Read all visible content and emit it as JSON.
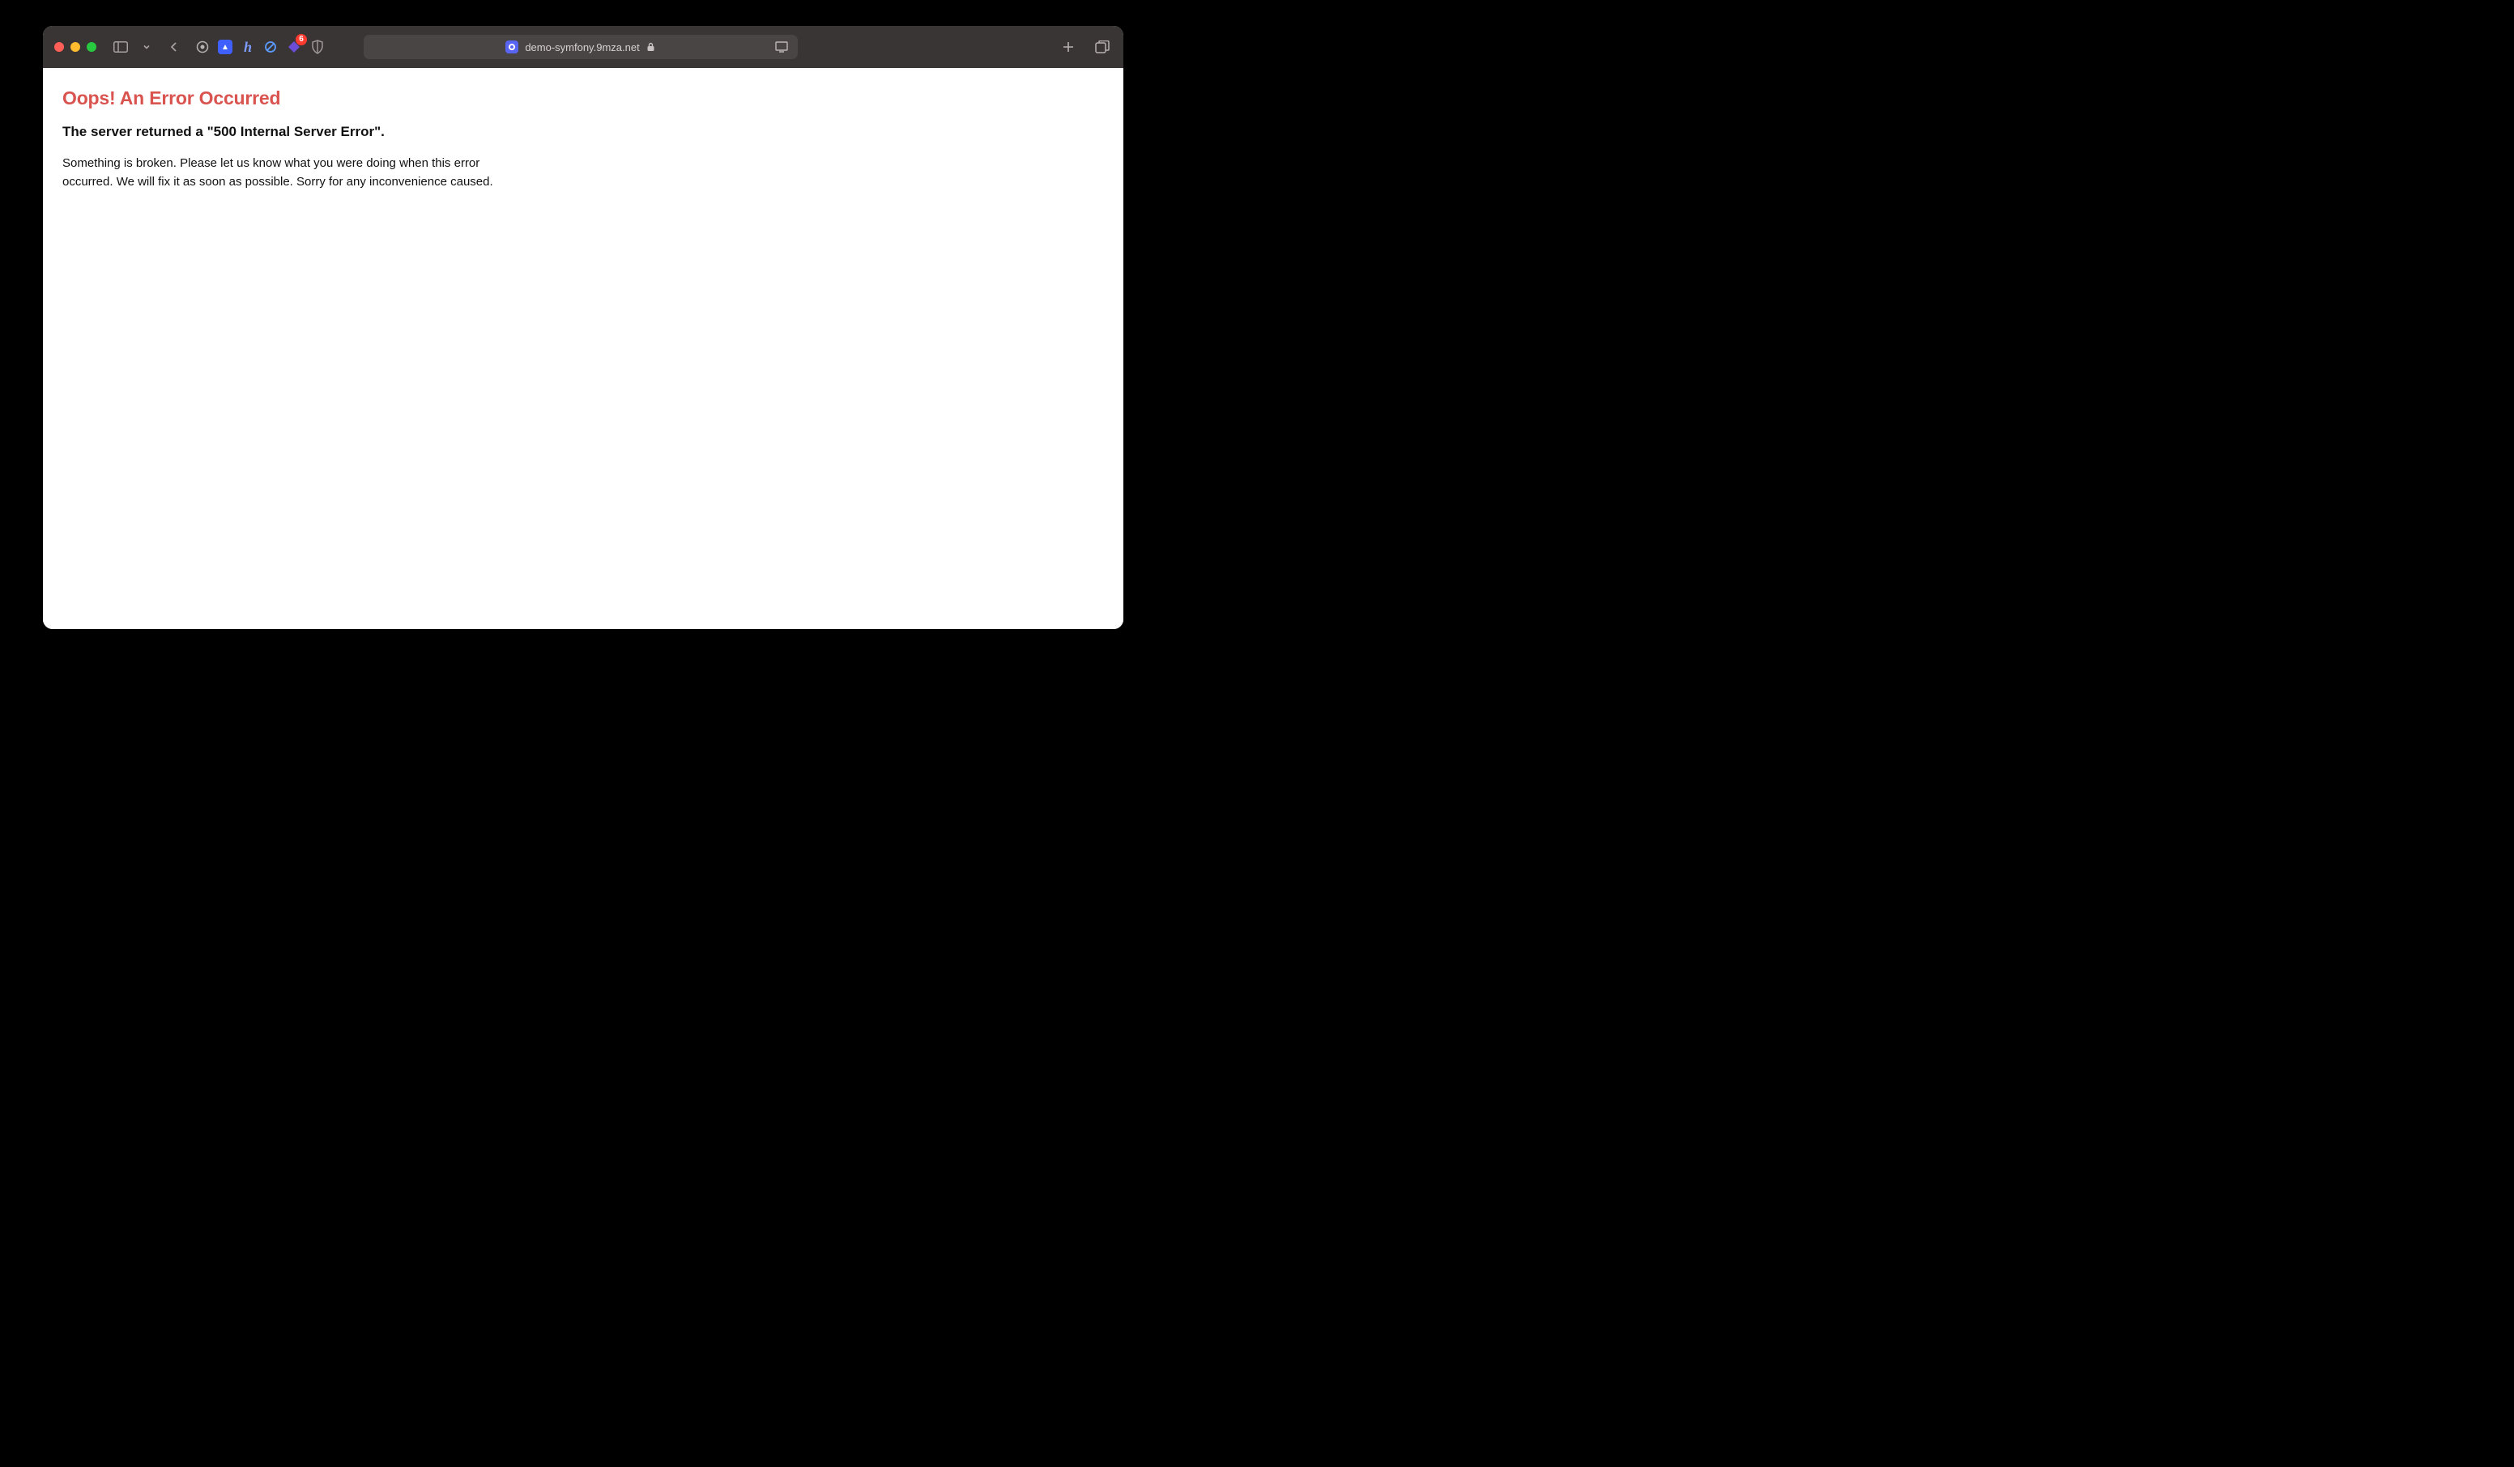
{
  "browser": {
    "address": "demo-symfony.9mza.net",
    "badge_count": "6"
  },
  "page": {
    "heading": "Oops! An Error Occurred",
    "subheading": "The server returned a \"500 Internal Server Error\".",
    "body": "Something is broken. Please let us know what you were doing when this error occurred. We will fix it as soon as possible. Sorry for any inconvenience caused."
  }
}
